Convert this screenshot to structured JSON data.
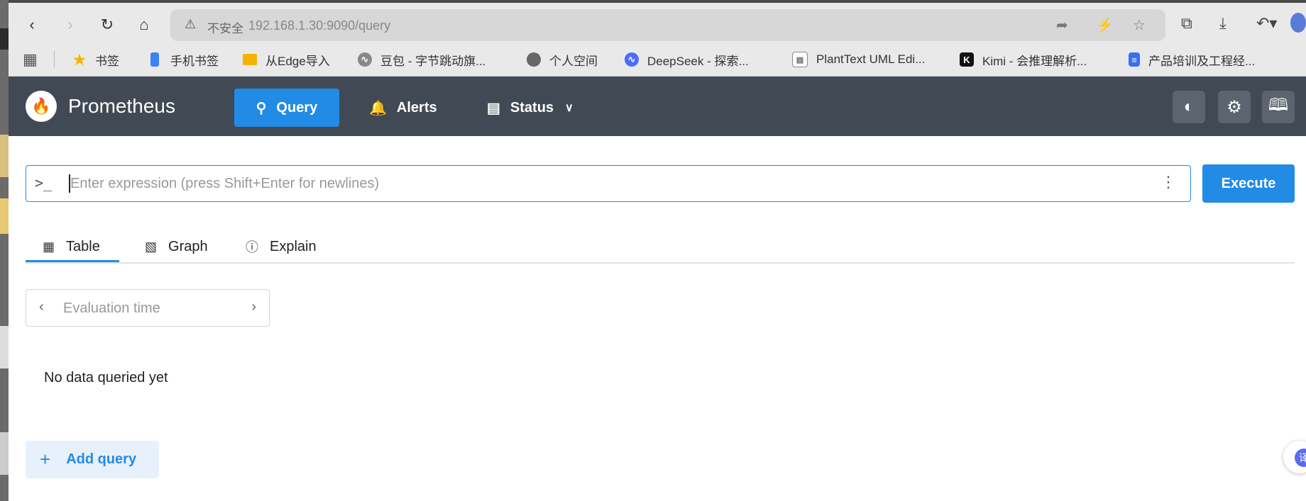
{
  "browser": {
    "address": {
      "insecure_label": "不安全",
      "url": "192.168.1.30:9090/query"
    },
    "bookmarks": [
      {
        "label": "书签",
        "icon": "star-icon",
        "color": "#f5b300"
      },
      {
        "label": "手机书签",
        "icon": "phone-icon",
        "color": "#3b82f6"
      },
      {
        "label": "从Edge导入",
        "icon": "folder-icon",
        "color": "#f5b300"
      },
      {
        "label": "豆包 - 字节跳动旗...",
        "icon": "doubao-icon",
        "color": "#555555"
      },
      {
        "label": "个人空间",
        "icon": "globe-icon",
        "color": "#555555"
      },
      {
        "label": "DeepSeek - 探索...",
        "icon": "deepseek-icon",
        "color": "#4d6bfe"
      },
      {
        "label": "PlantText UML Edi...",
        "icon": "planttext-icon",
        "color": "#666666"
      },
      {
        "label": "Kimi - 会推理解析...",
        "icon": "kimi-icon",
        "color": "#111111"
      },
      {
        "label": "产品培训及工程经...",
        "icon": "doc-icon",
        "color": "#3b6cf6"
      }
    ]
  },
  "app": {
    "brand": "Prometheus",
    "nav": {
      "query": "Query",
      "alerts": "Alerts",
      "status": "Status"
    },
    "accent": "#228be6",
    "header_bg": "#414a54"
  },
  "query": {
    "placeholder": "Enter expression (press Shift+Enter for newlines)",
    "value": "",
    "execute": "Execute"
  },
  "tabs": [
    "Table",
    "Graph",
    "Explain"
  ],
  "active_tab": "Table",
  "eval_time": {
    "placeholder": "Evaluation time"
  },
  "result": {
    "empty": "No data queried yet"
  },
  "add_query": "Add query",
  "translate_badge": "译"
}
